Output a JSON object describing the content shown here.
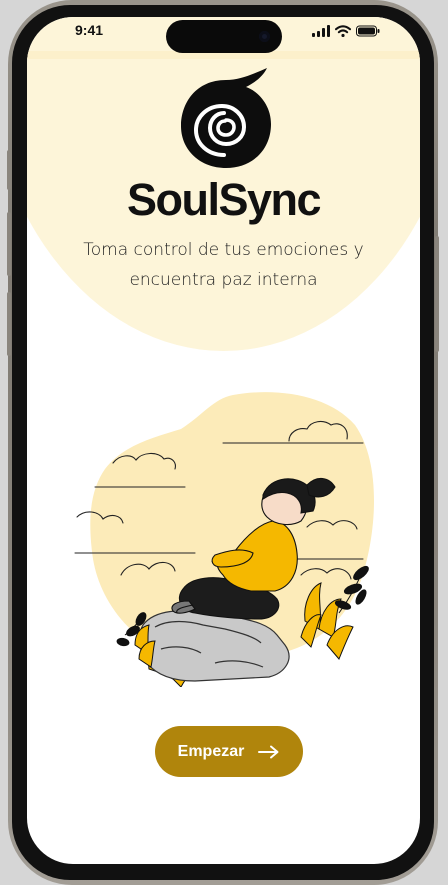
{
  "status_bar": {
    "time": "9:41"
  },
  "app": {
    "name": "SoulSync",
    "tagline": "Toma control de tus emociones y encuentra paz interna"
  },
  "cta": {
    "label": "Empezar",
    "icon": "arrow-right-icon"
  },
  "colors": {
    "accent": "#b0850c",
    "background_glow": "#fdf5d9",
    "illustration_yellow": "#f5b800",
    "blob": "#fcebb9"
  }
}
